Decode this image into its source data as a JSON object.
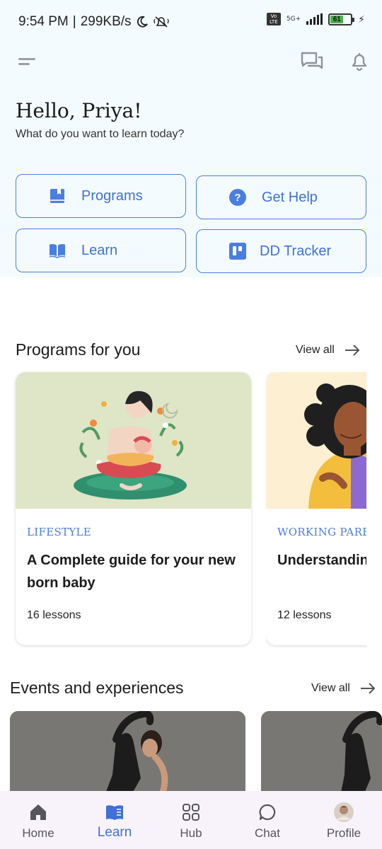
{
  "status_bar": {
    "time": "9:54 PM",
    "separator": "|",
    "speed": "299KB/s",
    "volte_label": "Vo LTE",
    "network": "5G+",
    "battery": "61",
    "icons": [
      "moon-icon",
      "silent-bell-icon",
      "signal-icon",
      "battery-icon",
      "charging-icon"
    ]
  },
  "header": {
    "menu_icon": "menu-icon",
    "chat_icon": "chat-bubbles-icon",
    "bell_icon": "bell-icon"
  },
  "greeting": {
    "title": "Hello, Priya!",
    "subtitle": "What do you want to learn today?"
  },
  "quick_actions": [
    {
      "label": "Programs",
      "icon": "bookmark-book-icon"
    },
    {
      "label": "Get Help",
      "icon": "question-circle-icon"
    },
    {
      "label": "Learn",
      "icon": "open-book-icon"
    },
    {
      "label": "DD Tracker",
      "icon": "tracker-board-icon"
    }
  ],
  "programs": {
    "title": "Programs for you",
    "view_all": "View all",
    "cards": [
      {
        "tag": "LIFESTYLE",
        "title": "A Complete guide for your new born baby",
        "lessons": "16 lessons"
      },
      {
        "tag": "WORKING PARENTS",
        "title": "Understanding behaviour",
        "lessons": "12 lessons"
      }
    ]
  },
  "events": {
    "title": "Events and experiences",
    "view_all": "View all"
  },
  "bottom_nav": {
    "items": [
      {
        "label": "Home",
        "icon": "home-icon"
      },
      {
        "label": "Learn",
        "icon": "book-icon"
      },
      {
        "label": "Hub",
        "icon": "grid-icon"
      },
      {
        "label": "Chat",
        "icon": "chat-icon"
      },
      {
        "label": "Profile",
        "icon": "avatar-icon"
      }
    ],
    "active": "Learn"
  },
  "colors": {
    "accent": "#3f70d8",
    "top_bg": "#f4fbfe",
    "nav_bg": "#f8f3fa",
    "card_image_1_bg": "#dfe5c7",
    "card_image_2_bg": "#fcefd2"
  }
}
